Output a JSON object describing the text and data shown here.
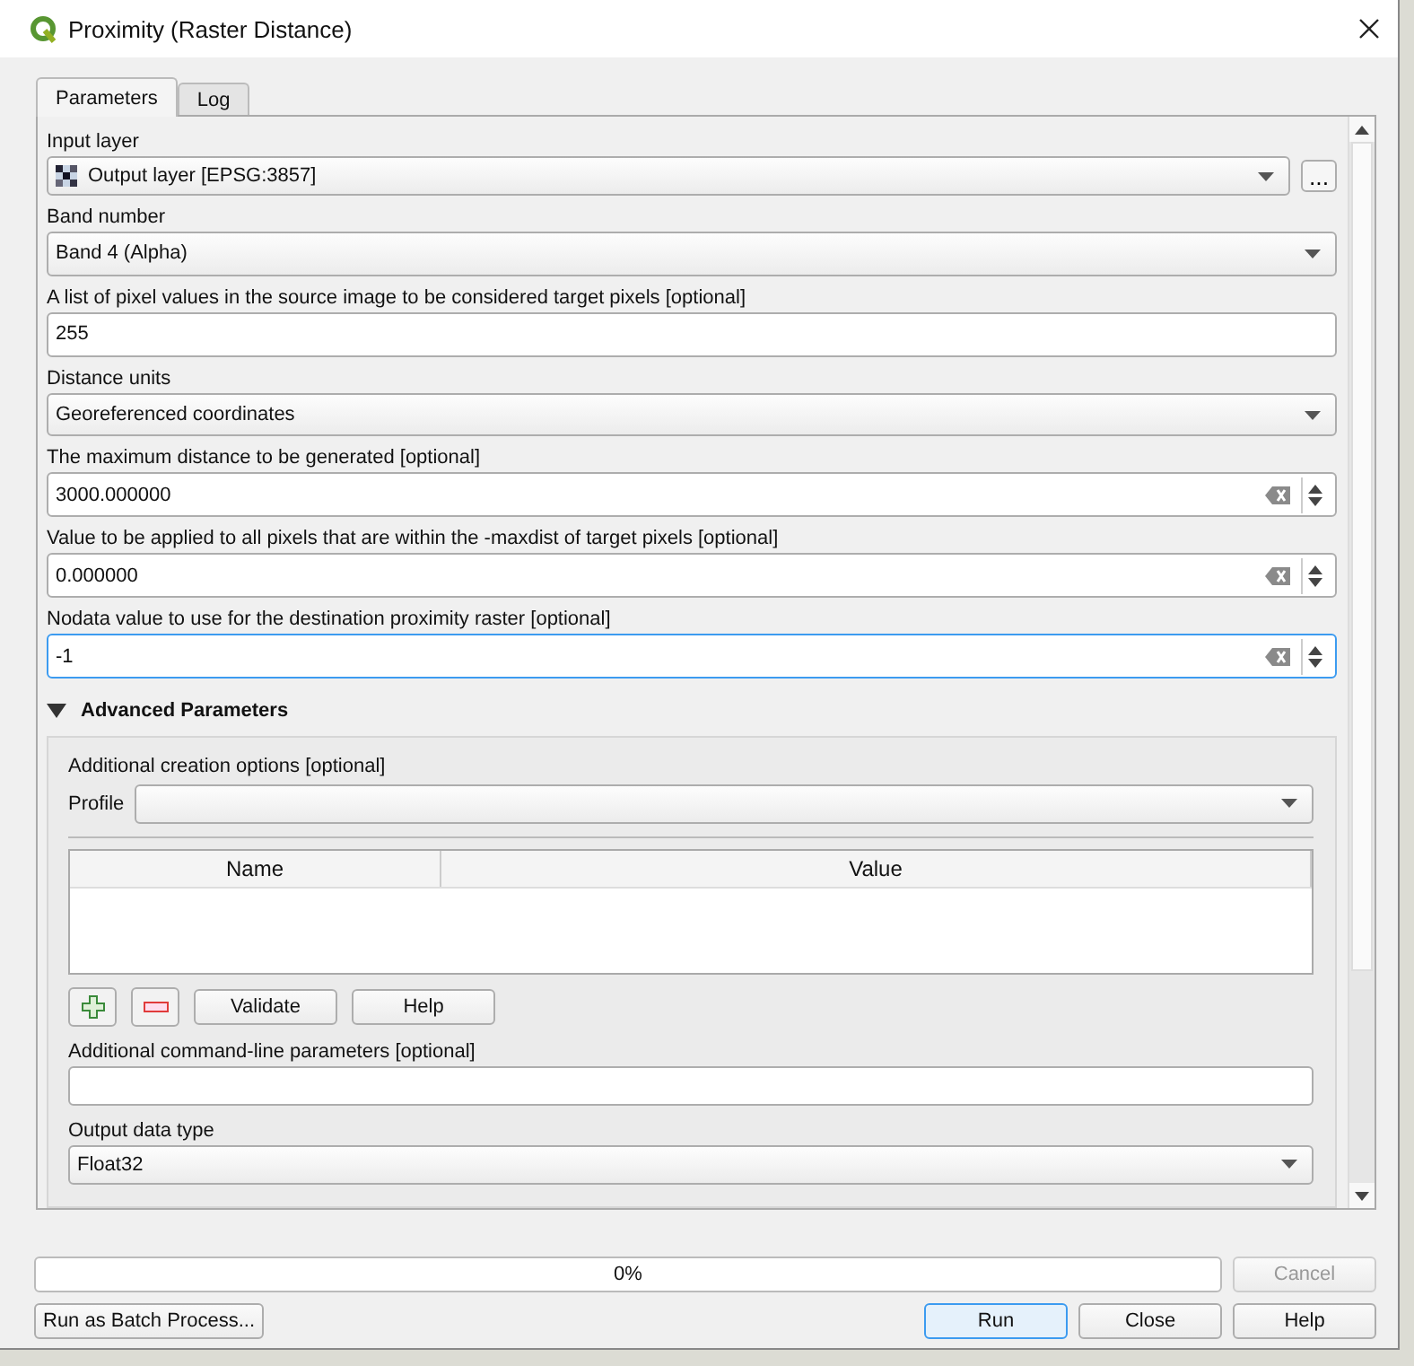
{
  "window": {
    "title": "Proximity (Raster Distance)"
  },
  "tabs": [
    {
      "label": "Parameters",
      "selected": true
    },
    {
      "label": "Log",
      "selected": false
    }
  ],
  "params": [
    {
      "kind": "layer",
      "label": "Input layer",
      "value": "Output layer [EPSG:3857]",
      "browse": "..."
    },
    {
      "kind": "combo",
      "label": "Band number",
      "value": "Band 4 (Alpha)"
    },
    {
      "kind": "text",
      "label": "A list of pixel values in the source image to be considered target pixels [optional]",
      "value": "255"
    },
    {
      "kind": "combo",
      "label": "Distance units",
      "value": "Georeferenced coordinates"
    },
    {
      "kind": "spin",
      "label": "The maximum distance to be generated [optional]",
      "value": "3000.000000",
      "focused": false
    },
    {
      "kind": "spin",
      "label": "Value to be applied to all pixels that are within the -maxdist of target pixels [optional]",
      "value": "0.000000",
      "focused": false
    },
    {
      "kind": "spin",
      "label": "Nodata value to use for the destination proximity raster [optional]",
      "value": "-1",
      "focused": true
    }
  ],
  "advanced": {
    "title": "Advanced Parameters",
    "expanded": true,
    "creation_label": "Additional creation options [optional]",
    "profile_label": "Profile",
    "columns": [
      "Name",
      "Value"
    ],
    "validate": "Validate",
    "help": "Help",
    "cmdline_label": "Additional command-line parameters [optional]",
    "type_label": "Output data type",
    "type_value": "Float32"
  },
  "progress": {
    "level": 0,
    "text": "0%"
  },
  "cancel": {
    "label": "Cancel",
    "disabled": true
  },
  "batch": "Run as Batch Process...",
  "buttons": [
    {
      "label": "Run",
      "default": true
    },
    {
      "label": "Close",
      "default": false
    },
    {
      "label": "Help",
      "default": false
    }
  ]
}
